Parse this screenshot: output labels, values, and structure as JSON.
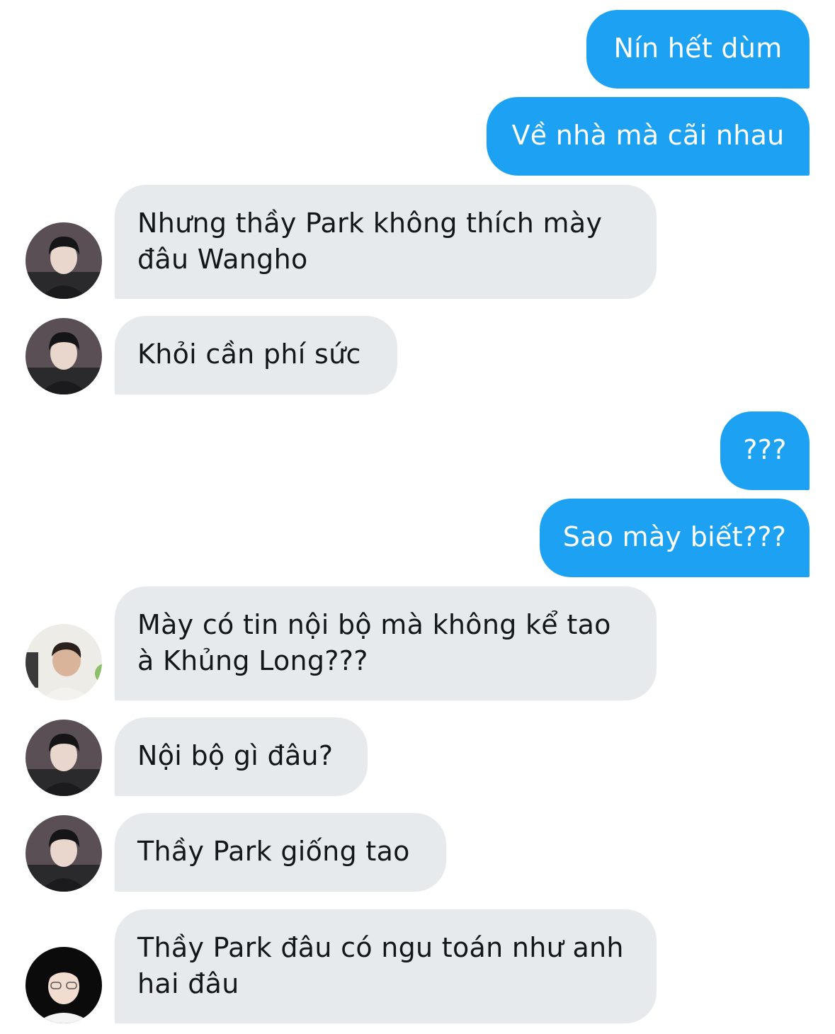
{
  "colors": {
    "outgoing_bubble": "#1da1f2",
    "incoming_bubble": "#e7eaed",
    "outgoing_text": "#ffffff",
    "incoming_text": "#14171a"
  },
  "messages": [
    {
      "sender": "me",
      "text": "Nín hết dùm"
    },
    {
      "sender": "me",
      "text": "Về nhà mà cãi nhau"
    },
    {
      "sender": "avatar-a",
      "text": "Nhưng thầy Park không thích mày",
      "text2": "đâu Wangho"
    },
    {
      "sender": "avatar-a",
      "text": "Khỏi cần phí sức"
    },
    {
      "sender": "me",
      "text": "???"
    },
    {
      "sender": "me",
      "text": "Sao mày biết???"
    },
    {
      "sender": "avatar-b",
      "text": "Mày có tin nội bộ mà không kể tao",
      "text2": "à Khủng Long???"
    },
    {
      "sender": "avatar-a",
      "text": "Nội bộ gì đâu?"
    },
    {
      "sender": "avatar-a",
      "text": "Thầy Park giống tao"
    },
    {
      "sender": "avatar-c",
      "text": "Thầy Park đâu có ngu toán như anh",
      "text2": "hai đâu"
    }
  ]
}
